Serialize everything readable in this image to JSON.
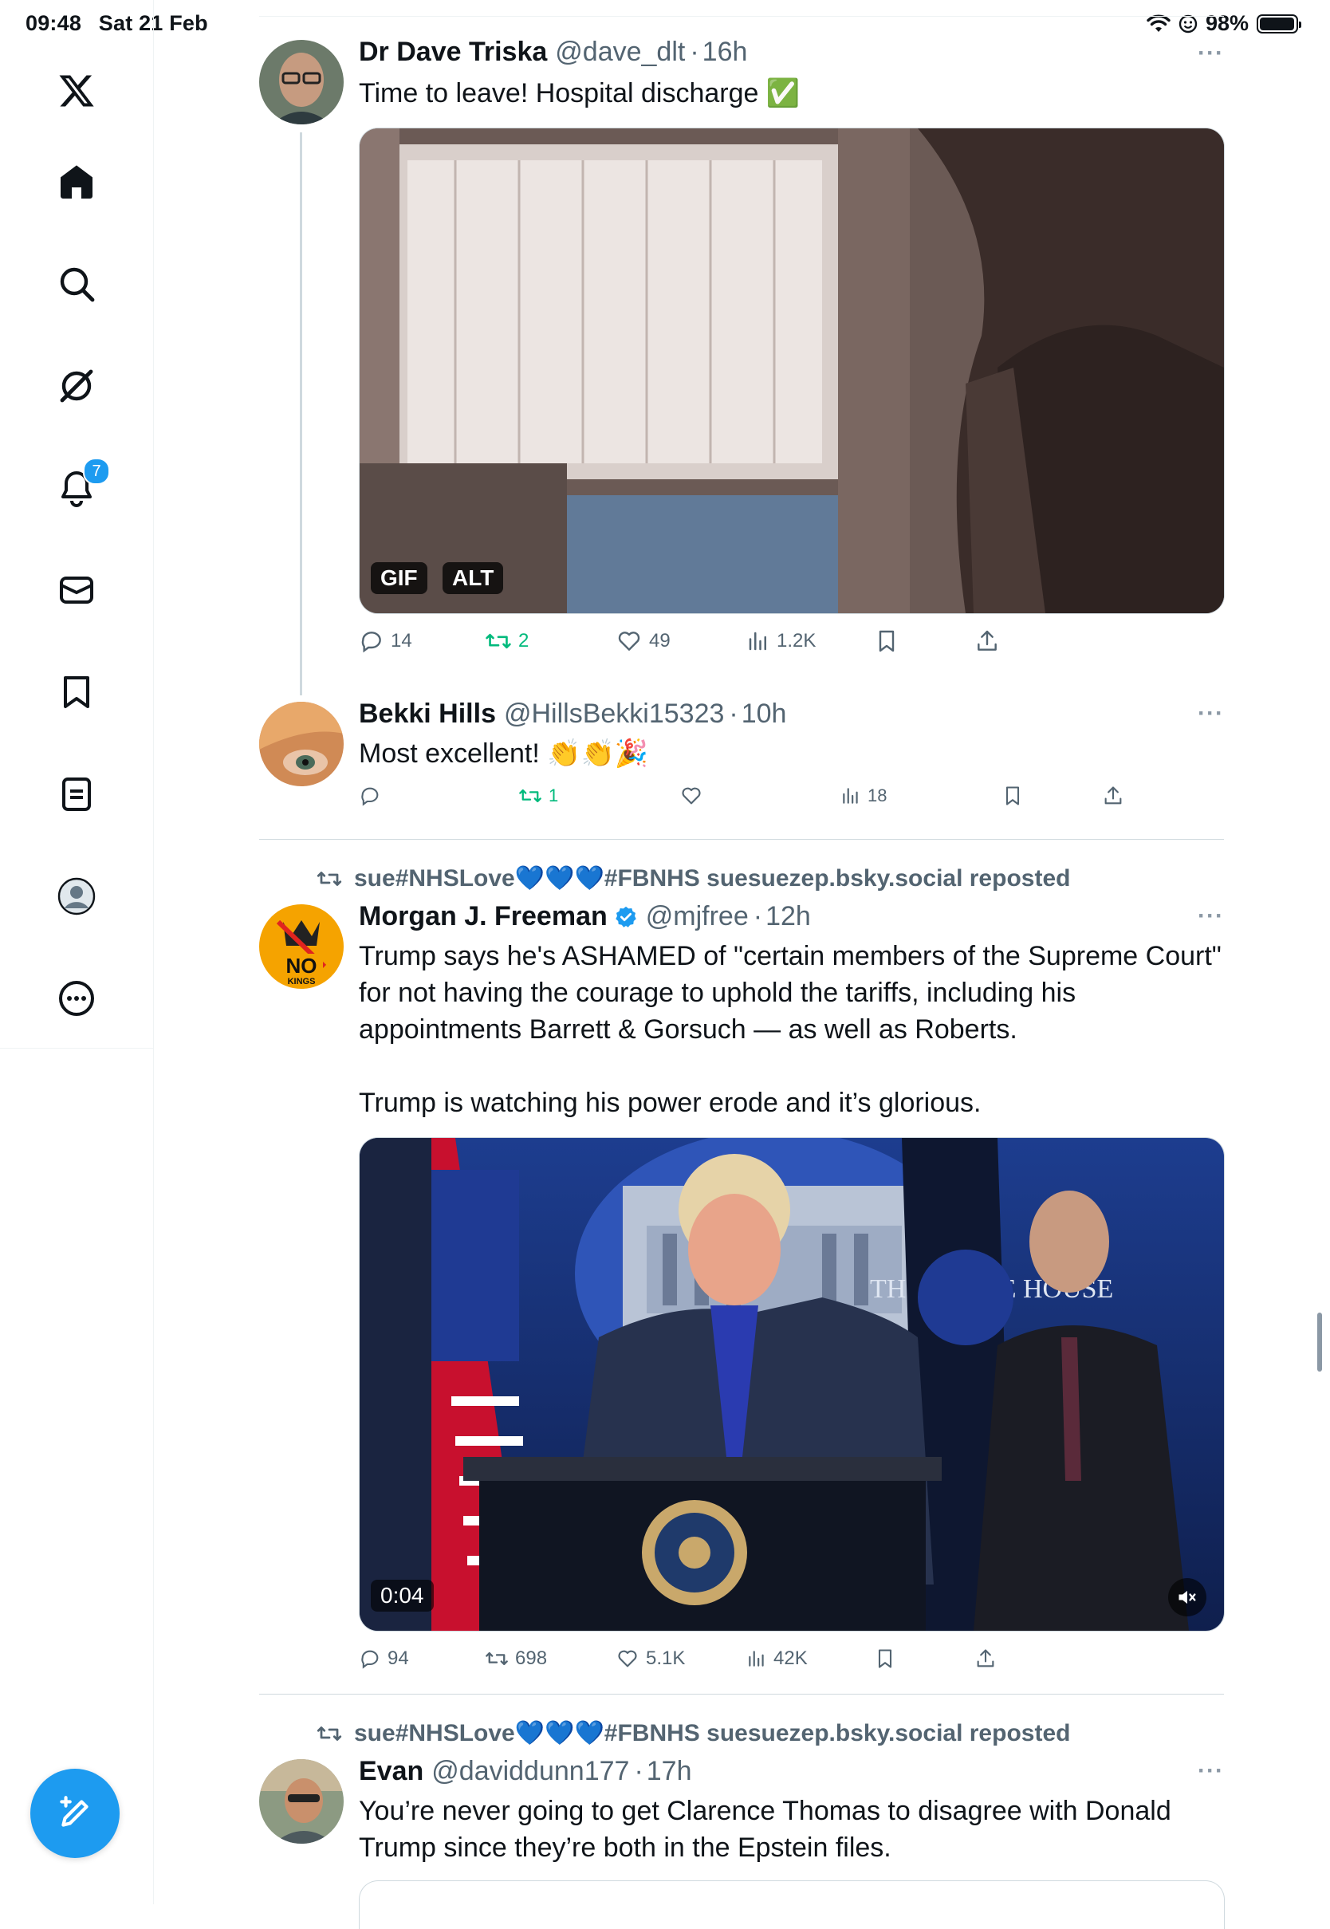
{
  "status_bar": {
    "time": "09:48",
    "date": "Sat 21 Feb",
    "battery": "98%",
    "battery_level": 0.98
  },
  "sidebar": {
    "items": [
      {
        "name": "x-logo"
      },
      {
        "name": "home"
      },
      {
        "name": "search"
      },
      {
        "name": "grok"
      },
      {
        "name": "notifications",
        "badge": "7"
      },
      {
        "name": "messages"
      },
      {
        "name": "bookmarks"
      },
      {
        "name": "lists"
      },
      {
        "name": "profile"
      },
      {
        "name": "more"
      }
    ]
  },
  "tweets": [
    {
      "name": "Dr Dave Triska",
      "handle": "@dave_dlt",
      "time": "16h",
      "text": "Time to leave! Hospital discharge ✅",
      "media": {
        "type": "gif",
        "tags": [
          "GIF",
          "ALT"
        ]
      },
      "stats": {
        "replies": "14",
        "reposts": "2",
        "likes": "49",
        "views": "1.2K"
      }
    },
    {
      "name": "Bekki Hills",
      "handle": "@HillsBekki15323",
      "time": "10h",
      "text": "Most excellent! 👏👏🎉",
      "stats": {
        "replies": "",
        "reposts": "1",
        "likes": "",
        "views": "18"
      }
    },
    {
      "reposted_by": "sue#NHSLove💙💙💙#FBNHS suesuezep.bsky.social reposted",
      "name": "Morgan J. Freeman",
      "verified": true,
      "handle": "@mjfree",
      "time": "12h",
      "text": "Trump says he's ASHAMED of \"certain members of the Supreme Court\" for not having the courage to uphold the tariffs, including his appointments Barrett & Gorsuch — as well as Roberts.\n\nTrump is watching his power erode and it’s glorious.",
      "avatar_text": "NO KINGS",
      "media": {
        "type": "video",
        "duration": "0:04",
        "caption": "THE WHITE HOUSE"
      },
      "stats": {
        "replies": "94",
        "reposts": "698",
        "likes": "5.1K",
        "views": "42K"
      }
    },
    {
      "reposted_by": "sue#NHSLove💙💙💙#FBNHS suesuezep.bsky.social reposted",
      "name": "Evan",
      "handle": "@daviddunn177",
      "time": "17h",
      "text": "You’re never going to get Clarence Thomas to disagree with Donald Trump since they’re both in the Epstein files."
    }
  ],
  "colors": {
    "accent": "#1d9bf0",
    "repost_green": "#00ba7c",
    "muted": "#536471"
  }
}
